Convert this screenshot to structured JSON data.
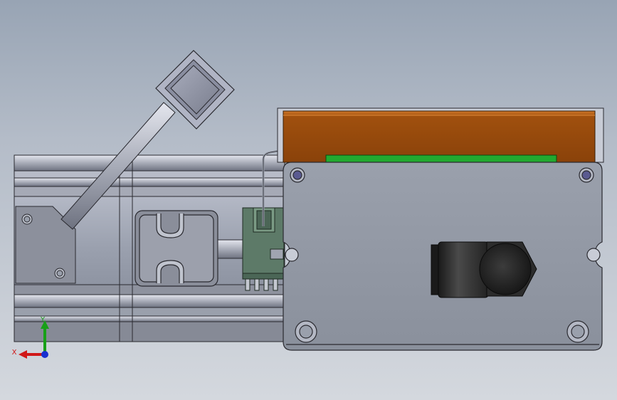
{
  "viewport": {
    "background_top": "#98a4b4",
    "background_bottom": "#d4d8de"
  },
  "model": {
    "parts": [
      "motor-body",
      "rotary-handle",
      "gear-rack",
      "electronics-board",
      "driver-housing",
      "connector-plug"
    ],
    "colors": {
      "body_gray": "#9aa0ae",
      "outline": "#2a2a30",
      "board_orange": "#9a4a10",
      "board_green": "#22aa30",
      "connector_green": "#5d7a68",
      "plug_black": "#2a2a2a",
      "screw_blue": "#5a5a90"
    }
  },
  "triad": {
    "x_label": "X",
    "y_label": "Y",
    "x_color": "#d01818",
    "y_color": "#18a018",
    "z_color": "#1830d0"
  }
}
